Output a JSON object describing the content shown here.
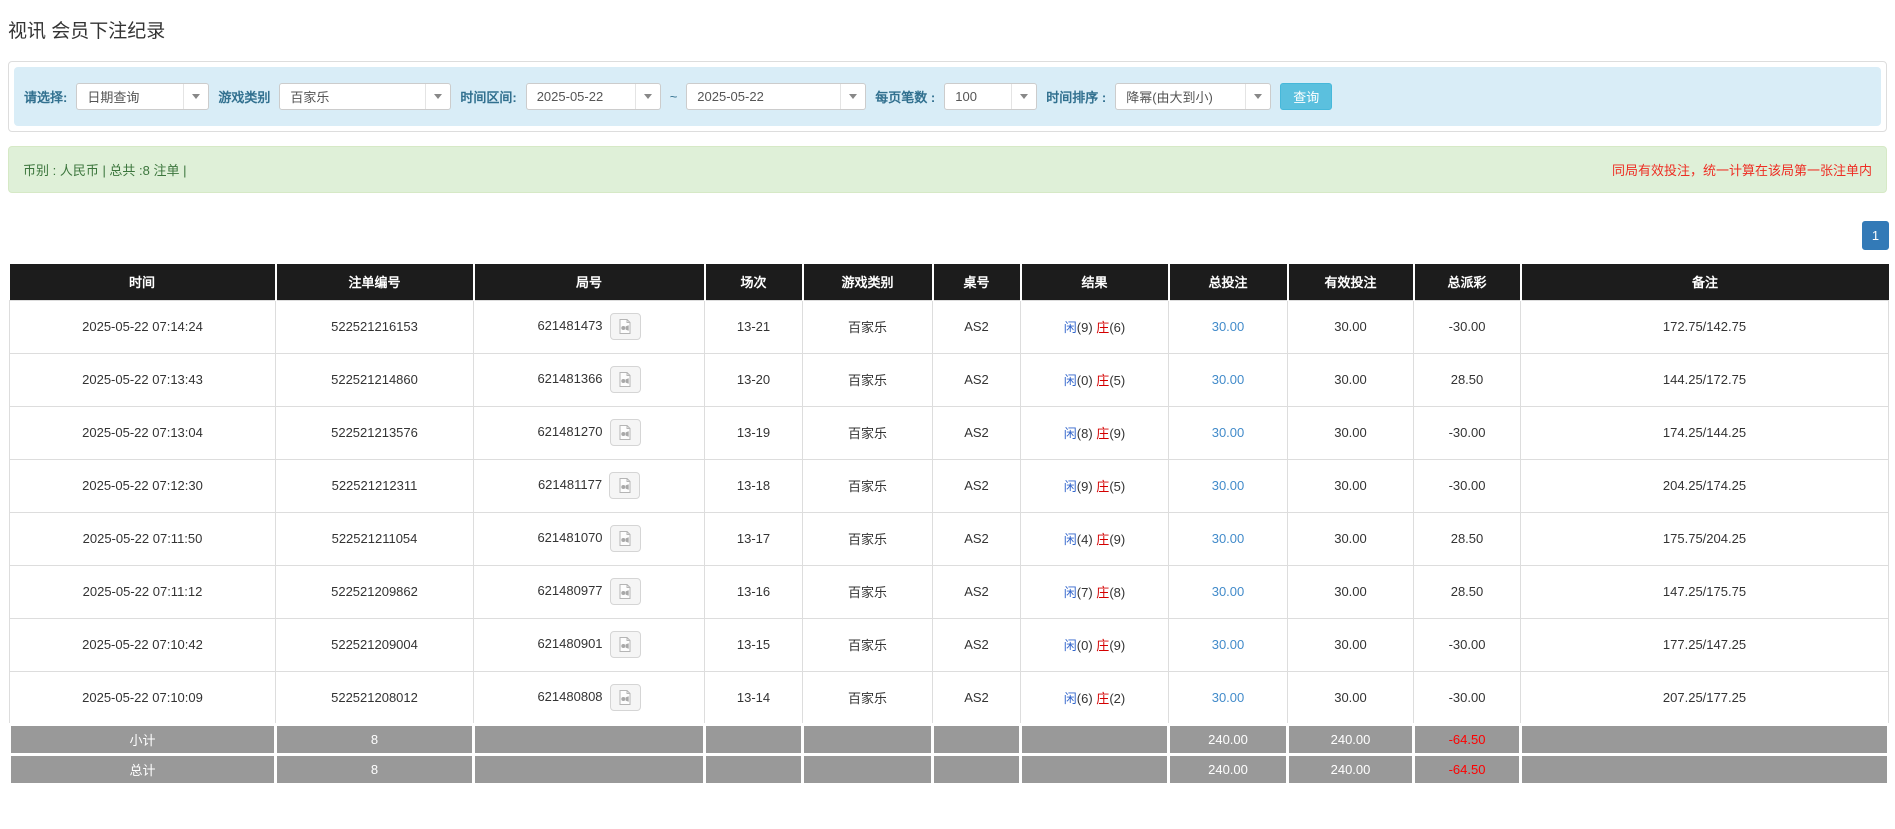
{
  "page": {
    "title": "视讯 会员下注纪录"
  },
  "filters": {
    "select_label": "请选择:",
    "select_value": "日期查询",
    "game_label": "游戏类别",
    "game_value": "百家乐",
    "range_label": "时间区间:",
    "date_from": "2025-05-22",
    "tilde": "~",
    "date_to": "2025-05-22",
    "per_page_label": "每页笔数 :",
    "per_page_value": "100",
    "sort_label": "时间排序 :",
    "sort_value": "降幂(由大到小)",
    "query_button": "查询"
  },
  "summary_bar": {
    "left_text": "币别 : 人民币 | 总共 :8 注单 |",
    "right_text": "同局有效投注，统一计算在该局第一张注单内"
  },
  "pagination": {
    "page": "1"
  },
  "icons": {
    "dropdown_caret": "caret-down-icon",
    "video": "video-file-icon"
  },
  "table": {
    "headers": [
      "时间",
      "注单编号",
      "局号",
      "场次",
      "游戏类别",
      "桌号",
      "结果",
      "总投注",
      "有效投注",
      "总派彩",
      "备注"
    ],
    "rows": [
      {
        "time": "2025-05-22 07:14:24",
        "bet_id": "522521216153",
        "round_id": "621481473",
        "session": "13-21",
        "game": "百家乐",
        "table_no": "AS2",
        "player": "闲",
        "player_score": "(9)",
        "banker": "庄",
        "banker_score": "(6)",
        "total_bet": "30.00",
        "valid_bet": "30.00",
        "payout": "-30.00",
        "note": "172.75/142.75"
      },
      {
        "time": "2025-05-22 07:13:43",
        "bet_id": "522521214860",
        "round_id": "621481366",
        "session": "13-20",
        "game": "百家乐",
        "table_no": "AS2",
        "player": "闲",
        "player_score": "(0)",
        "banker": "庄",
        "banker_score": "(5)",
        "total_bet": "30.00",
        "valid_bet": "30.00",
        "payout": "28.50",
        "note": "144.25/172.75"
      },
      {
        "time": "2025-05-22 07:13:04",
        "bet_id": "522521213576",
        "round_id": "621481270",
        "session": "13-19",
        "game": "百家乐",
        "table_no": "AS2",
        "player": "闲",
        "player_score": "(8)",
        "banker": "庄",
        "banker_score": "(9)",
        "total_bet": "30.00",
        "valid_bet": "30.00",
        "payout": "-30.00",
        "note": "174.25/144.25"
      },
      {
        "time": "2025-05-22 07:12:30",
        "bet_id": "522521212311",
        "round_id": "621481177",
        "session": "13-18",
        "game": "百家乐",
        "table_no": "AS2",
        "player": "闲",
        "player_score": "(9)",
        "banker": "庄",
        "banker_score": "(5)",
        "total_bet": "30.00",
        "valid_bet": "30.00",
        "payout": "-30.00",
        "note": "204.25/174.25"
      },
      {
        "time": "2025-05-22 07:11:50",
        "bet_id": "522521211054",
        "round_id": "621481070",
        "session": "13-17",
        "game": "百家乐",
        "table_no": "AS2",
        "player": "闲",
        "player_score": "(4)",
        "banker": "庄",
        "banker_score": "(9)",
        "total_bet": "30.00",
        "valid_bet": "30.00",
        "payout": "28.50",
        "note": "175.75/204.25"
      },
      {
        "time": "2025-05-22 07:11:12",
        "bet_id": "522521209862",
        "round_id": "621480977",
        "session": "13-16",
        "game": "百家乐",
        "table_no": "AS2",
        "player": "闲",
        "player_score": "(7)",
        "banker": "庄",
        "banker_score": "(8)",
        "total_bet": "30.00",
        "valid_bet": "30.00",
        "payout": "28.50",
        "note": "147.25/175.75"
      },
      {
        "time": "2025-05-22 07:10:42",
        "bet_id": "522521209004",
        "round_id": "621480901",
        "session": "13-15",
        "game": "百家乐",
        "table_no": "AS2",
        "player": "闲",
        "player_score": "(0)",
        "banker": "庄",
        "banker_score": "(9)",
        "total_bet": "30.00",
        "valid_bet": "30.00",
        "payout": "-30.00",
        "note": "177.25/147.25"
      },
      {
        "time": "2025-05-22 07:10:09",
        "bet_id": "522521208012",
        "round_id": "621480808",
        "session": "13-14",
        "game": "百家乐",
        "table_no": "AS2",
        "player": "闲",
        "player_score": "(6)",
        "banker": "庄",
        "banker_score": "(2)",
        "total_bet": "30.00",
        "valid_bet": "30.00",
        "payout": "-30.00",
        "note": "207.25/177.25"
      }
    ],
    "subtotal": {
      "label": "小计",
      "count": "8",
      "total_bet": "240.00",
      "valid_bet": "240.00",
      "payout": "-64.50"
    },
    "total": {
      "label": "总计",
      "count": "8",
      "total_bet": "240.00",
      "valid_bet": "240.00",
      "payout": "-64.50"
    }
  },
  "colors": {
    "header_bg": "#1c1c1c",
    "filter_bar_bg": "#d9edf7",
    "alert_bg": "#dff0d8",
    "alert_text": "#3c763d",
    "warn_text": "#ee2e24",
    "query_btn": "#5bc0de",
    "pagination_btn": "#337ab7",
    "player_blue": "#3366cc",
    "banker_red": "#d40000",
    "negative_red": "#ff0000",
    "summary_bg": "#999999",
    "link_blue": "#428bca"
  }
}
